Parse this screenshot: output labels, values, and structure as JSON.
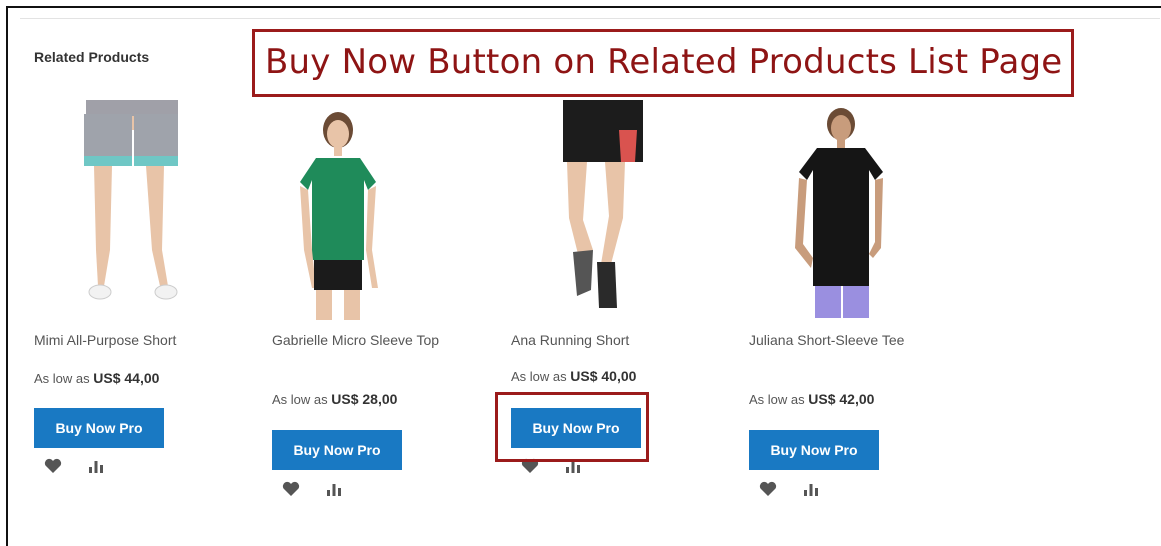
{
  "section_title": "Related Products",
  "annotation": "Buy Now Button on Related Products List Page",
  "products": [
    {
      "name": "Mimi All-Purpose Short",
      "price_prefix": "As low as",
      "price": "US$ 44,00",
      "button": "Buy Now Pro"
    },
    {
      "name": "Gabrielle Micro Sleeve Top",
      "price_prefix": "As low as",
      "price": "US$ 28,00",
      "button": "Buy Now Pro"
    },
    {
      "name": "Ana Running Short",
      "price_prefix": "As low as",
      "price": "US$ 40,00",
      "button": "Buy Now Pro"
    },
    {
      "name": "Juliana Short-Sleeve Tee",
      "price_prefix": "As low as",
      "price": "US$ 42,00",
      "button": "Buy Now Pro"
    }
  ],
  "icons": {
    "wishlist": "heart-icon",
    "compare": "bar-chart-icon"
  },
  "colors": {
    "button": "#1979c3",
    "annotation": "#9b1b1b"
  }
}
